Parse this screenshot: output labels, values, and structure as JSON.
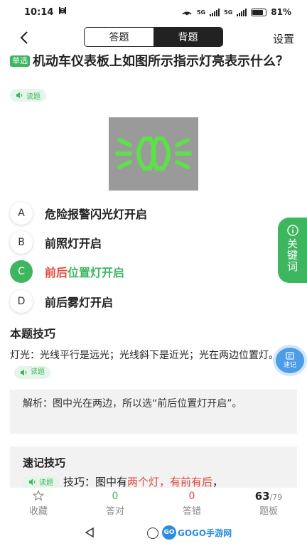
{
  "status": {
    "time": "10:14",
    "battery": "81%",
    "battery_level": 0.81,
    "net1": "5G",
    "net2": "5G"
  },
  "nav": {
    "tab_answer": "答题",
    "tab_memorize": "背题",
    "settings": "设置"
  },
  "question": {
    "type_badge": "单选",
    "text": "机动车仪表板上如图所示指示灯亮表示什么？",
    "read_label": "读题"
  },
  "options": [
    {
      "letter": "A",
      "text": "危险报警闪光灯开启",
      "state": "normal"
    },
    {
      "letter": "B",
      "text": "前照灯开启",
      "state": "normal"
    },
    {
      "letter": "C",
      "text_red": "前后",
      "text_green": "位置灯开启",
      "state": "correct"
    },
    {
      "letter": "D",
      "text": "前后雾灯开启",
      "state": "normal"
    }
  ],
  "side_tab": {
    "label": "关键词"
  },
  "tips": {
    "title": "本题技巧",
    "text": "灯光：光线平行是远光；光线斜下是近光；光在两边位置灯。",
    "read_label": "读题"
  },
  "float_button": {
    "label": "速记"
  },
  "analysis": {
    "text": "解析：图中光在两边，所以选“前后位置灯开启”。"
  },
  "memo": {
    "title": "速记技巧",
    "read_label": "读题",
    "prefix": "技巧：图中有",
    "highlight": "两个灯，有前有后",
    "suffix": "，"
  },
  "bottom_bar": {
    "collect_label": "收藏",
    "correct_count": "0",
    "correct_label": "答对",
    "wrong_count": "0",
    "wrong_label": "答错",
    "progress_current": "63",
    "progress_total": "/79",
    "progress_label": "题板"
  },
  "watermark": {
    "logo": "GO",
    "text": "GOGO手游网"
  },
  "colors": {
    "green": "#3db65f",
    "red": "#e5453c",
    "dark": "#222222",
    "blue": "#4b9de8"
  }
}
